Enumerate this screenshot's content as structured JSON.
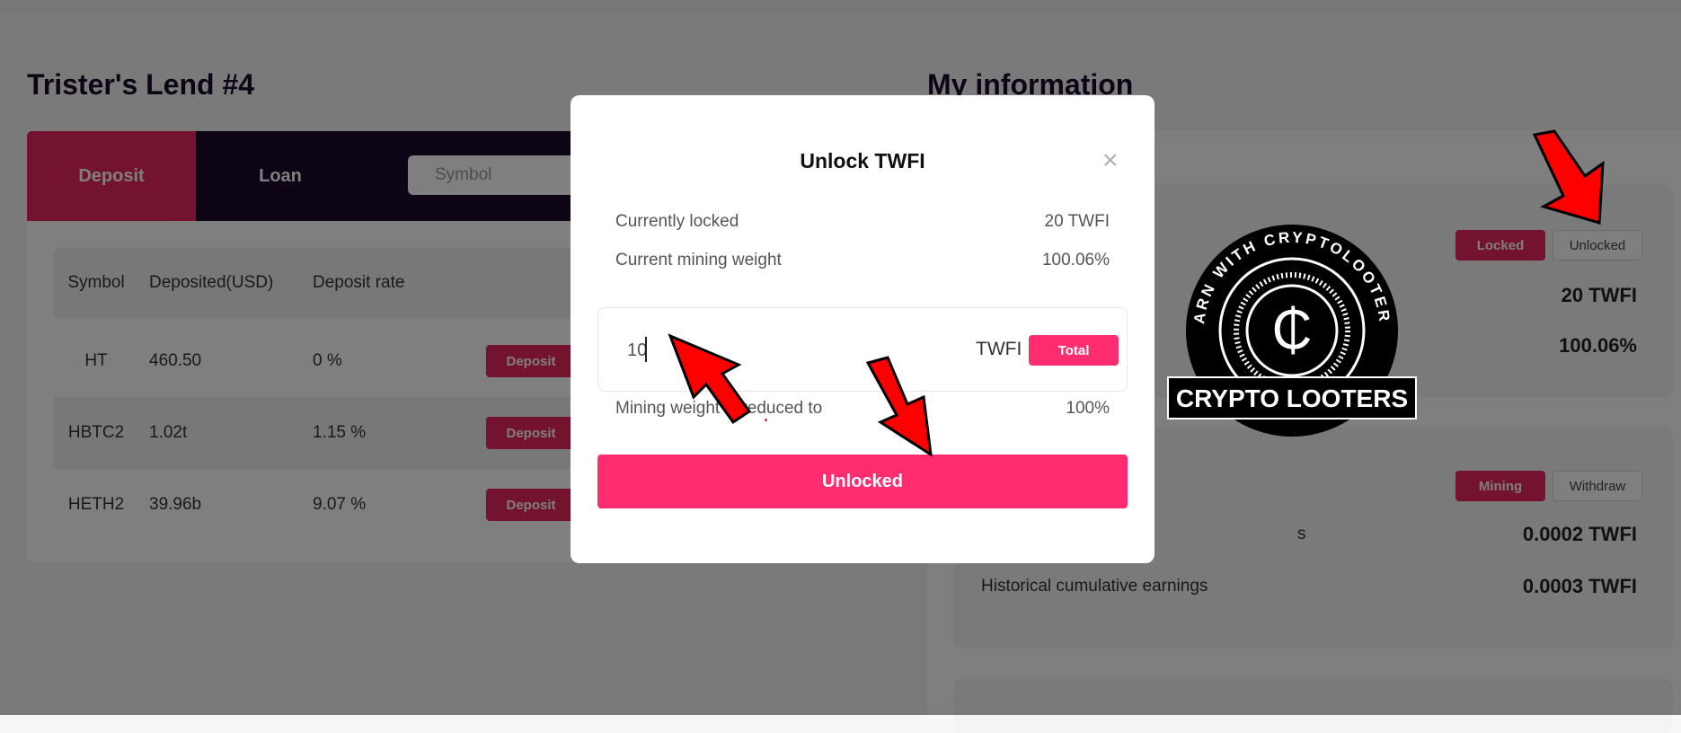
{
  "lend": {
    "title": "Trister's Lend #4",
    "tabs": {
      "deposit": "Deposit",
      "loan": "Loan"
    },
    "search_placeholder": "Symbol",
    "columns": [
      "Symbol",
      "Deposited(USD)",
      "Deposit rate"
    ],
    "rows": [
      {
        "symbol": "HT",
        "deposited": "460.50",
        "rate": "0 %",
        "action": "Deposit"
      },
      {
        "symbol": "HBTC2",
        "deposited": "1.02t",
        "rate": "1.15 %",
        "action": "Deposit"
      },
      {
        "symbol": "HETH2",
        "deposited": "39.96b",
        "rate": "9.07 %",
        "action": "Deposit"
      }
    ]
  },
  "info": {
    "title": "My information",
    "lock_card": {
      "locked_label": "Locked",
      "unlocked_label": "Unlocked",
      "locked_value": "20 TWFI",
      "weight_value": "100.06%"
    },
    "mining_card": {
      "mining_label": "Mining",
      "withdraw_label": "Withdraw",
      "earnings_label_fragment": "s",
      "earnings_value": "0.0002 TWFI",
      "historical_label": "Historical cumulative earnings",
      "historical_value": "0.0003 TWFI"
    }
  },
  "modal": {
    "title": "Unlock TWFI",
    "close_symbol": "×",
    "currently_locked_label": "Currently locked",
    "currently_locked_value": "20 TWFI",
    "weight_label": "Current mining weight",
    "weight_value": "100.06%",
    "amount_value": "10",
    "unit": "TWFI",
    "total_label": "Total",
    "reduced_label": "Mining weight is reduced to",
    "reduced_value": "100%",
    "submit_label": "Unlocked"
  },
  "watermark": {
    "ring_text": "EARN WITH CRYPTOLOOTERS",
    "banner_text": "CRYPTO LOOTERS",
    "symbol": "₵"
  },
  "colors": {
    "accent": "#e8265e",
    "modal_accent": "#ff2d6f",
    "dark": "#1b0a2a",
    "arrow": "#ff0000"
  },
  "icons": [
    "close-icon",
    "red-arrow-annotation",
    "crypto-looters-logo"
  ]
}
